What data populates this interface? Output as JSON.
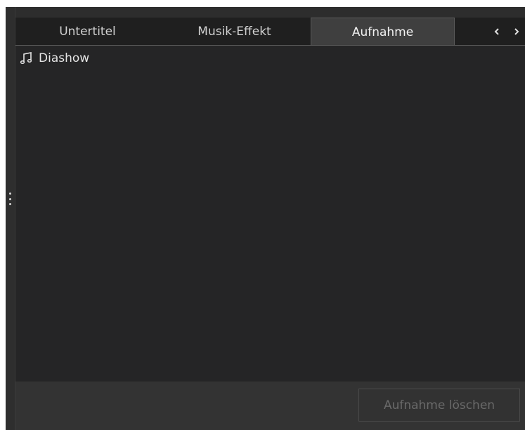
{
  "tabs": {
    "items": [
      {
        "label": "Untertitel"
      },
      {
        "label": "Musik-Effekt"
      },
      {
        "label": "Aufnahme"
      }
    ],
    "active_index": 2
  },
  "tree": {
    "items": [
      {
        "icon": "music-note-icon",
        "label": "Diashow"
      }
    ]
  },
  "footer": {
    "delete_button_label": "Aufnahme löschen",
    "delete_button_enabled": false
  },
  "colors": {
    "panel_background": "#2d2d2d",
    "content_background": "#252526",
    "active_tab_background": "#3f3f3f",
    "text": "#e4e4e4",
    "disabled_text": "#6a6a6a"
  }
}
